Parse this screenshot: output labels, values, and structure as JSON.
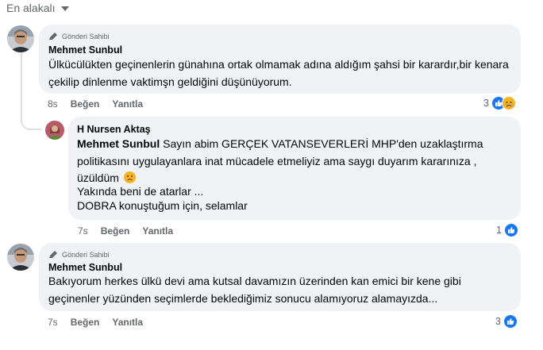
{
  "sort": {
    "label": "En alakalı"
  },
  "comments": [
    {
      "badge": "Gönderi Sahibi",
      "author": "Mehmet Sunbul",
      "text": "Ülkücülükten geçinenlerin günahına ortak olmamak adına aldığım şahsi bir karardır,bir kenara çekilip dinlenme vaktimşn geldiğini düşünüyorum.",
      "time": "8s",
      "like_label": "Beğen",
      "reply_label": "Yanıtla",
      "reaction_count": "3",
      "reactions": [
        "like-icon",
        "sad-icon"
      ]
    },
    {
      "author": "H Nursen Aktaş",
      "mention": "Mehmet Sunbul",
      "text_line1": " Sayın abim GERÇEK VATANSEVERLERİ MHP'den uzaklaştırma politikasını uygulayanlara inat mücadele etmeliyiz ama saygı duyarım kararınıza , üzüldüm",
      "text_line2": "Yakında beni de atarlar ...",
      "text_line3": "DOBRA konuştuğum için, selamlar",
      "time": "7s",
      "like_label": "Beğen",
      "reply_label": "Yanıtla",
      "reaction_count": "1",
      "reactions": [
        "like-icon"
      ]
    },
    {
      "badge": "Gönderi Sahibi",
      "author": "Mehmet Sunbul",
      "text": "Bakıyorum herkes ülkü devi ama kutsal davamızın üzerinden kan emici bir kene gibi geçinenler yüzünden seçimlerde beklediğimiz sonucu alamıyoruz alamayızda...",
      "time": "7s",
      "like_label": "Beğen",
      "reply_label": "Yanıtla",
      "reaction_count": "3",
      "reactions": [
        "like-icon"
      ]
    }
  ],
  "colors": {
    "accent": "#1877f2",
    "bubble": "#f0f2f5",
    "muted": "#65676b",
    "sad": "#f7b125"
  }
}
